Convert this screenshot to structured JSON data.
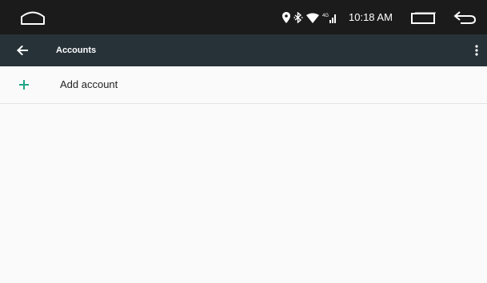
{
  "status_bar": {
    "time": "10:18 AM",
    "icons": [
      "location-icon",
      "bluetooth-icon",
      "wifi-icon",
      "cell-signal-icon"
    ]
  },
  "nav_buttons": [
    "home-button",
    "recents-button",
    "back-button"
  ],
  "app_bar": {
    "title": "Accounts",
    "up_icon": "arrow-back-icon",
    "menu_icon": "more-vert-icon"
  },
  "list": {
    "items": [
      {
        "label": "Add account",
        "icon": "plus-icon"
      }
    ]
  },
  "colors": {
    "status_bar": "#1b1b1b",
    "app_bar": "#263238",
    "accent": "#1fa588",
    "background": "#fafafa"
  }
}
